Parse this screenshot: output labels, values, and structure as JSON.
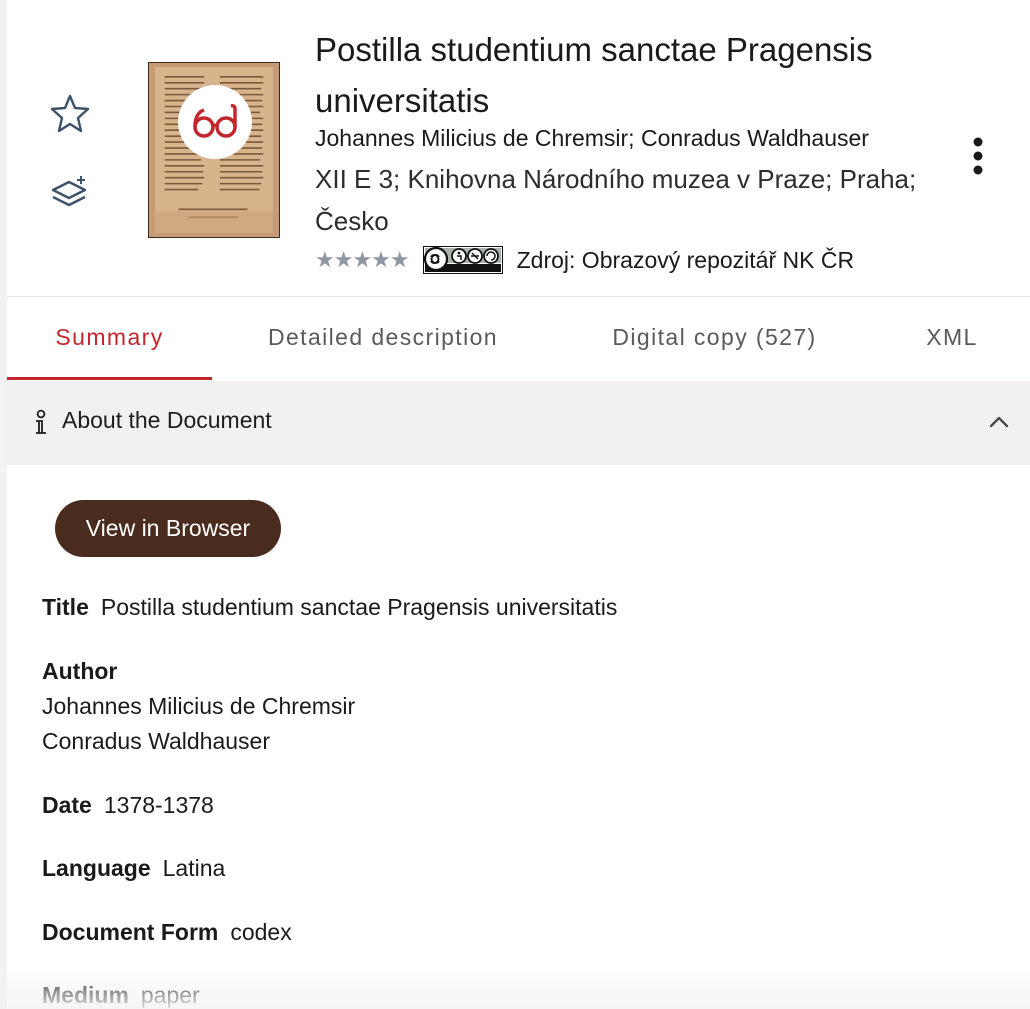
{
  "header": {
    "title": "Postilla studentium sanctae Pragensis universitatis",
    "authors": "Johannes Milicius de Chremsir; Conradus Waldhauser",
    "location": "XII E 3; Knihovna Národního muzea v Praze; Praha; Česko",
    "rating_stars": "★★★★★",
    "license_badge": "cc-by-nc-sa-badge",
    "source": "Zdroj: Obrazový repozitář NK ČR",
    "icons": [
      "star-outline-icon",
      "add-layers-icon",
      "reading-glasses-icon",
      "kebab-menu-icon"
    ],
    "accent_color": "#c2272d"
  },
  "tabs": [
    {
      "label": "Summary",
      "active": true
    },
    {
      "label": "Detailed description",
      "active": false
    },
    {
      "label": "Digital copy (527)",
      "active": false
    },
    {
      "label": "XML",
      "active": false
    }
  ],
  "section": {
    "title": "About the Document",
    "expanded": true,
    "view_button": "View in Browser",
    "button_color": "#4a2c1f"
  },
  "fields": {
    "title": {
      "label": "Title",
      "value": "Postilla studentium sanctae Pragensis universitatis"
    },
    "author": {
      "label": "Author",
      "values": [
        "Johannes Milicius de Chremsir",
        "Conradus Waldhauser"
      ]
    },
    "date": {
      "label": "Date",
      "value": "1378-1378"
    },
    "language": {
      "label": "Language",
      "value": "Latina"
    },
    "form": {
      "label": "Document Form",
      "value": "codex"
    },
    "medium": {
      "label": "Medium",
      "value": "paper"
    }
  }
}
